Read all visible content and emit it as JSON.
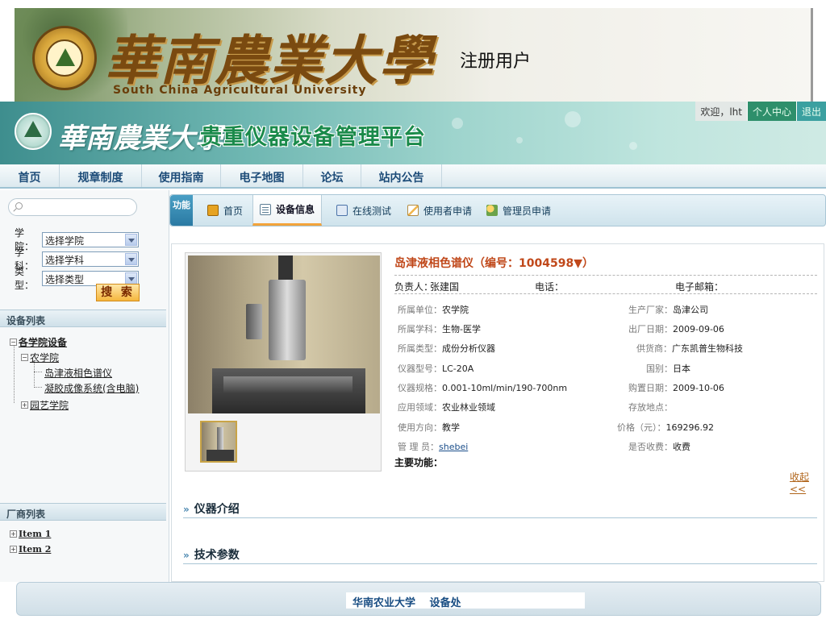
{
  "slide": {
    "university_cn": "華南農業大學",
    "university_en": "South China Agricultural University",
    "title": "注册用户"
  },
  "site_header": {
    "university_cn": "華南農業大學",
    "platform_name": "贵重仪器设备管理平台",
    "welcome": "欢迎，lht",
    "personal_center": "个人中心",
    "logout": "退出"
  },
  "main_nav": [
    {
      "label": "首页"
    },
    {
      "label": "规章制度"
    },
    {
      "label": "使用指南"
    },
    {
      "label": "电子地图"
    },
    {
      "label": "论坛"
    },
    {
      "label": "站内公告"
    }
  ],
  "sidebar": {
    "search_placeholder": "",
    "filters": [
      {
        "label": "学院：",
        "value": "选择学院"
      },
      {
        "label": "学科：",
        "value": "选择学科"
      },
      {
        "label": "类型：",
        "value": "选择类型"
      }
    ],
    "search_button": "搜 索",
    "device_list_header": "设备列表",
    "tree": {
      "root": "各学院设备",
      "college": "农学院",
      "items": [
        "岛津液相色谱仪",
        "凝胶成像系统(含电脑)"
      ],
      "college2": "园艺学院"
    },
    "vendor_list_header": "厂商列表",
    "vendor_items": [
      "Item 1",
      "Item 2"
    ]
  },
  "func_bar": {
    "label": "功能",
    "tabs": [
      {
        "label": "首页",
        "icon": "home-icon"
      },
      {
        "label": "设备信息",
        "icon": "device-info-icon",
        "active": true
      },
      {
        "label": "在线测试",
        "icon": "online-test-icon"
      },
      {
        "label": "使用者申请",
        "icon": "user-apply-icon"
      },
      {
        "label": "管理员申请",
        "icon": "admin-apply-icon"
      }
    ]
  },
  "device": {
    "title": "岛津液相色谱仪（编号：1004598▼）",
    "owner_label": "负责人：",
    "owner": "张建国",
    "phone_label": "电话：",
    "email_label": "电子邮箱：",
    "left_fields": [
      {
        "label": "所属单位：",
        "value": "农学院"
      },
      {
        "label": "所属学科：",
        "value": "生物-医学"
      },
      {
        "label": "所属类型：",
        "value": "成份分析仪器"
      },
      {
        "label": "仪器型号：",
        "value": "LC-20A"
      },
      {
        "label": "仪器规格：",
        "value": "0.001-10ml/min/190-700nm"
      },
      {
        "label": "应用领域：",
        "value": "农业林业领域"
      },
      {
        "label": "使用方向：",
        "value": "教学"
      },
      {
        "label": "管 理 员：",
        "value": "shebei",
        "link": true
      }
    ],
    "right_fields": [
      {
        "label": "生产厂家：",
        "value": "岛津公司"
      },
      {
        "label": "出厂日期：",
        "value": "2009-09-06"
      },
      {
        "label": "供货商：",
        "value": "广东凯普生物科技"
      },
      {
        "label": "国别：",
        "value": "日本"
      },
      {
        "label": "购置日期：",
        "value": "2009-10-06"
      },
      {
        "label": "存放地点：",
        "value": ""
      },
      {
        "label": "价格（元）：",
        "value": "169296.92"
      },
      {
        "label": "是否收费：",
        "value": "收费"
      }
    ],
    "main_function_label": "主要功能：",
    "collapse_link": "收起<<"
  },
  "sections": [
    {
      "label": "仪器介绍"
    },
    {
      "label": "技术参数"
    }
  ],
  "footer": {
    "text": "华南农业大学　 设备处"
  },
  "colors": {
    "accent": "#1a8a4a",
    "title_orange": "#c0481a",
    "nav_text": "#1c4b78"
  }
}
